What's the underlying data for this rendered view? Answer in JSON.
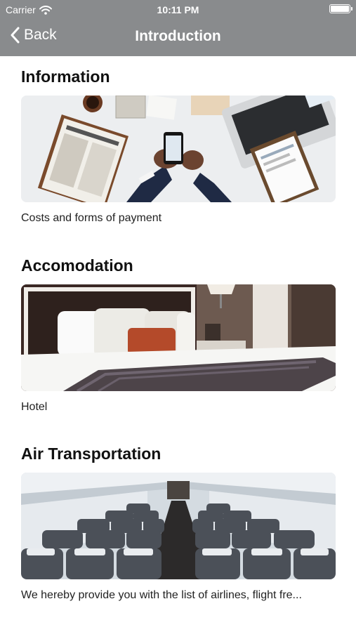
{
  "status_bar": {
    "carrier": "Carrier",
    "time": "10:11 PM",
    "icons": [
      "wifi-icon",
      "battery-icon"
    ]
  },
  "nav": {
    "back_label": "Back",
    "title": "Introduction",
    "back_icon": "chevron-left-icon"
  },
  "sections": [
    {
      "title": "Information",
      "caption": "Costs and forms of payment",
      "image": "business-desk-photo"
    },
    {
      "title": "Accomodation",
      "caption": "Hotel",
      "image": "hotel-bed-photo"
    },
    {
      "title": "Air Transportation",
      "caption": "We hereby provide you with the list of airlines, flight fre...",
      "image": "airplane-cabin-photo"
    }
  ],
  "colors": {
    "nav_bar": "#898b8d",
    "background": "#ffffff",
    "text": "#111111"
  }
}
